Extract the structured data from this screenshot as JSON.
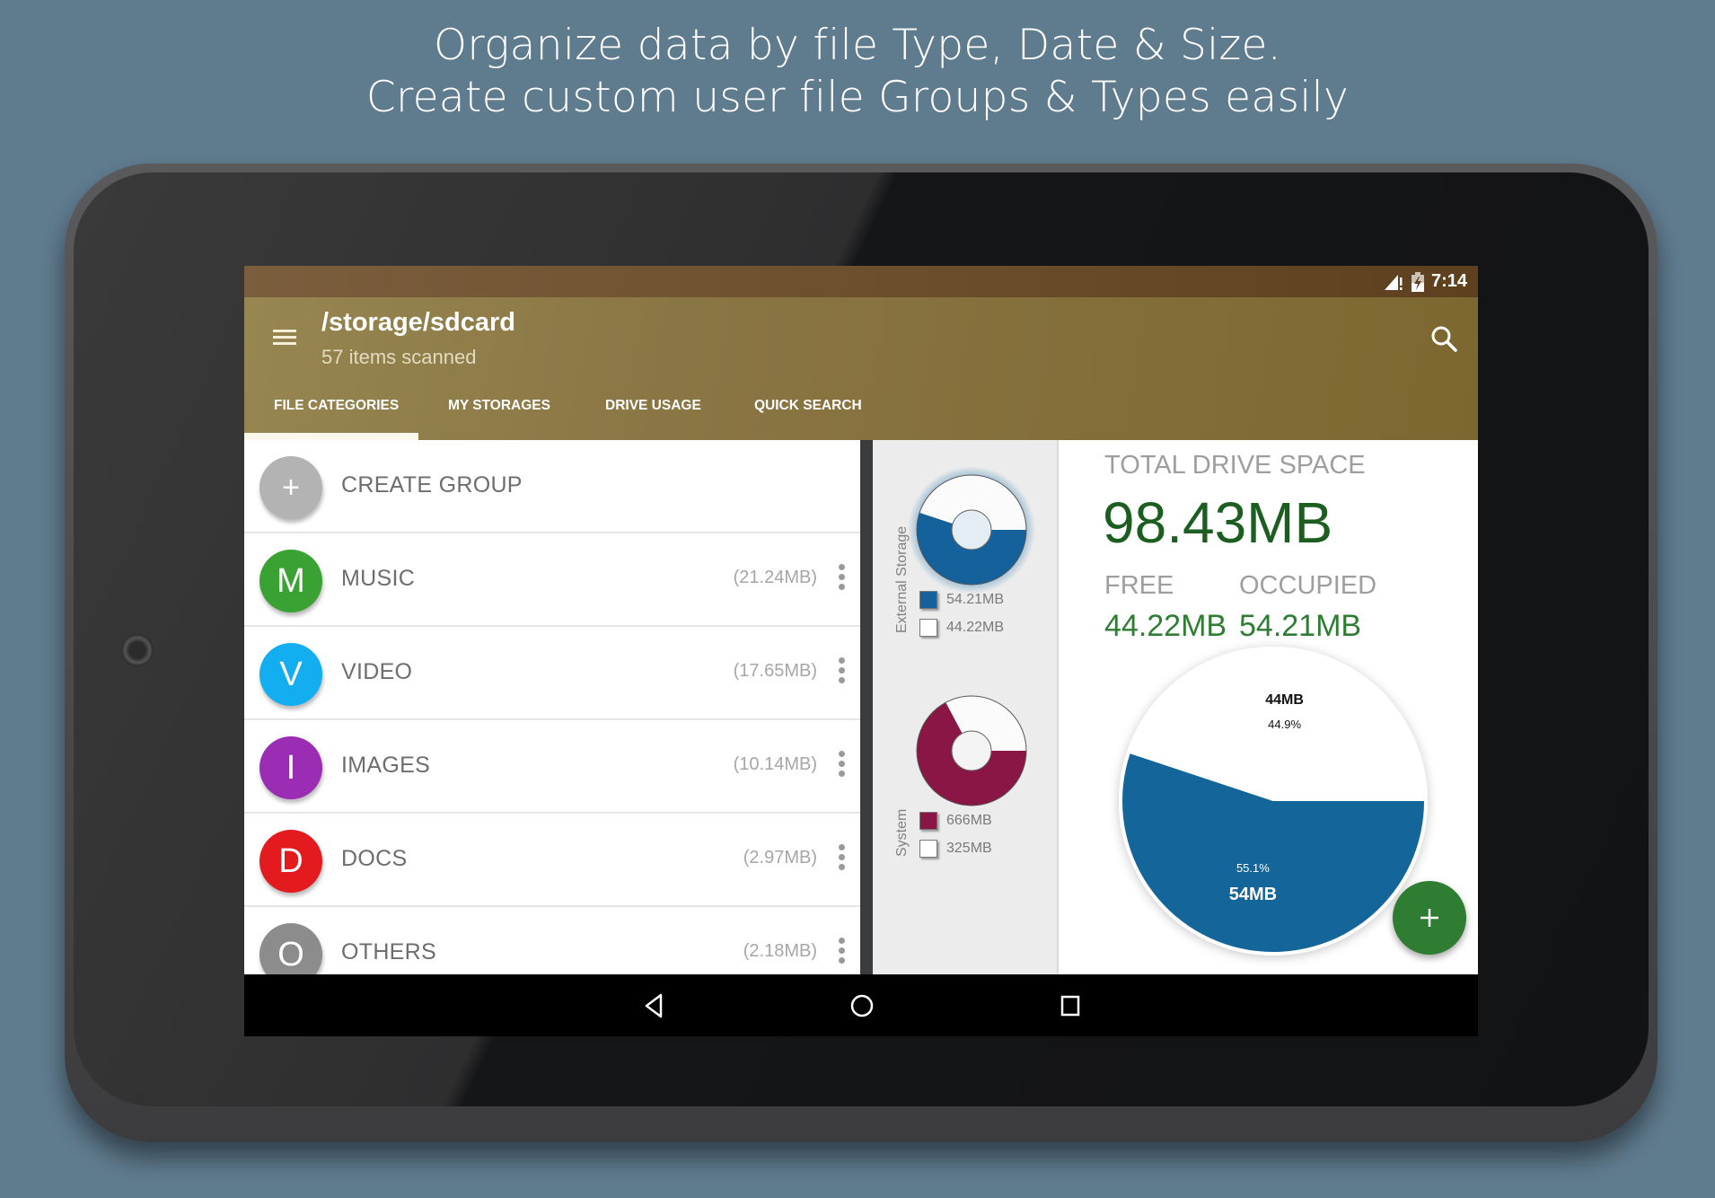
{
  "headline": {
    "line1": "Organize data by file Type, Date & Size.",
    "line2": "Create custom user file Groups & Types easily"
  },
  "status_bar": {
    "time": "7:14",
    "icons": [
      "signal-warning-icon",
      "battery-charging-icon"
    ]
  },
  "toolbar": {
    "menu_icon": "hamburger-menu-icon",
    "title": "/storage/sdcard",
    "subtitle": "57 items scanned",
    "search_icon": "search-icon"
  },
  "tabs": [
    {
      "label": "FILE CATEGORIES",
      "selected": true
    },
    {
      "label": "MY STORAGES",
      "selected": false
    },
    {
      "label": "DRIVE USAGE",
      "selected": false
    },
    {
      "label": "QUICK SEARCH",
      "selected": false
    }
  ],
  "categories": [
    {
      "letter": "+",
      "label": "CREATE GROUP",
      "size": "",
      "color": "#b3b3b3"
    },
    {
      "letter": "M",
      "label": "MUSIC",
      "size": "(21.24MB)",
      "color": "#3aa233"
    },
    {
      "letter": "V",
      "label": "VIDEO",
      "size": "(17.65MB)",
      "color": "#13aef0"
    },
    {
      "letter": "I",
      "label": "IMAGES",
      "size": "(10.14MB)",
      "color": "#9b2cb4"
    },
    {
      "letter": "D",
      "label": "DOCS",
      "size": "(2.97MB)",
      "color": "#e31b1e"
    },
    {
      "letter": "O",
      "label": "OTHERS",
      "size": "(2.18MB)",
      "color": "#8c8c8c"
    }
  ],
  "storages": [
    {
      "label": "External Storage",
      "color": "#14619b",
      "occupied_label": "54.21MB",
      "free_label": "44.22MB",
      "occupied": 54.21,
      "free": 44.22
    },
    {
      "label": "System",
      "color": "#8a1645",
      "occupied_label": "666MB",
      "free_label": "325MB",
      "occupied": 666,
      "free": 325
    }
  ],
  "drive": {
    "total_label": "TOTAL DRIVE SPACE",
    "total_value": "98.43MB",
    "free_label": "FREE",
    "occupied_label": "OCCUPIED",
    "free_value": "44.22MB",
    "occupied_value": "54.21MB"
  },
  "chart_data": {
    "type": "pie",
    "title": "",
    "slices": [
      {
        "name": "Free",
        "value": 44.9,
        "label": "44MB",
        "percent_label": "44.9%",
        "color": "#ffffff",
        "text_color": "#111111"
      },
      {
        "name": "Occupied",
        "value": 55.1,
        "label": "54MB",
        "percent_label": "55.1%",
        "color": "#14659a",
        "text_color": "#ffffff"
      }
    ],
    "legend": "none"
  },
  "fab": {
    "icon": "plus-icon"
  },
  "navbar": {
    "buttons": [
      "back-icon",
      "home-icon",
      "recents-icon"
    ]
  }
}
